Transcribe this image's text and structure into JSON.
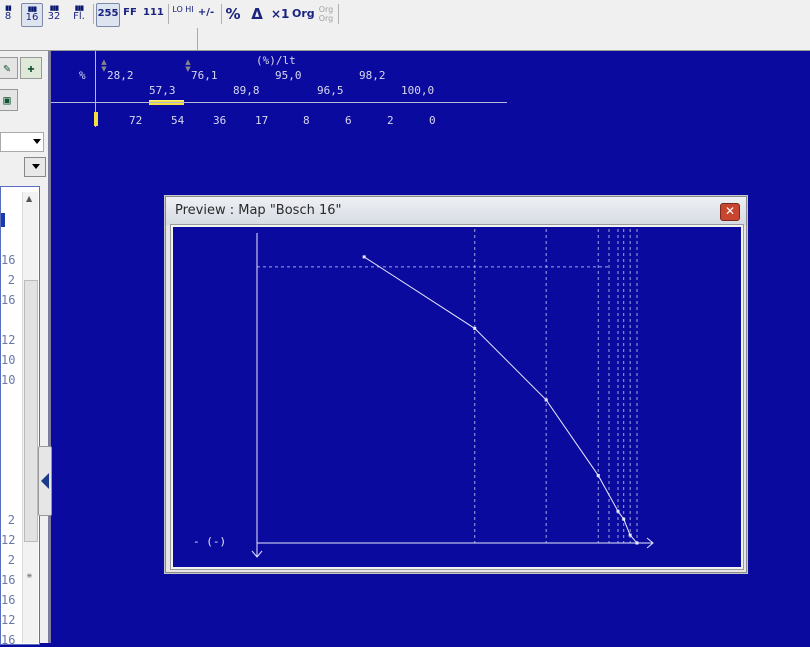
{
  "toolbar": {
    "buttons": [
      {
        "name": "8-bit-button",
        "label": "8",
        "selected": false
      },
      {
        "name": "16-bit-button",
        "label": "16",
        "selected": true
      },
      {
        "name": "32-bit-button",
        "label": "32",
        "selected": false
      },
      {
        "name": "float-button",
        "label": "Fl.",
        "selected": false
      },
      {
        "name": "decimal-255-button",
        "label": "255",
        "selected": true
      },
      {
        "name": "hex-ff-button",
        "label": "FF",
        "selected": false
      },
      {
        "name": "binary-111-button",
        "label": "111",
        "selected": false
      },
      {
        "name": "lohi-button",
        "label": "LO HI",
        "selected": false
      },
      {
        "name": "sign-button",
        "label": "+/-",
        "selected": false
      },
      {
        "name": "percent-button",
        "label": "%",
        "selected": false
      },
      {
        "name": "delta-button",
        "label": "Δ",
        "selected": false
      },
      {
        "name": "times-one-button",
        "label": "×1",
        "selected": false
      },
      {
        "name": "org-button",
        "label": "Org",
        "selected": false
      },
      {
        "name": "org-org-button",
        "label": "Org Org",
        "selected": false
      }
    ]
  },
  "map": {
    "unit_label": "(%)/lt",
    "row_label": "%",
    "axis_top": [
      "28,2",
      "76,1",
      "95,0",
      "98,2"
    ],
    "axis_bottom": [
      "57,3",
      "89,8",
      "96,5",
      "100,0"
    ],
    "values": [
      "72",
      "54",
      "36",
      "17",
      "8",
      "6",
      "2",
      "0"
    ]
  },
  "left_list": {
    "numbers": [
      "16",
      "2",
      "16",
      "12",
      "10",
      "10",
      "2",
      "12",
      "2",
      "16",
      "16",
      "12",
      "16"
    ]
  },
  "preview": {
    "title": "Preview : Map \"Bosch 16\"",
    "close_label": "✕",
    "axis_label": "- (-)"
  },
  "chart_data": {
    "type": "line",
    "x": [
      28.2,
      57.3,
      76.1,
      89.8,
      95.0,
      96.5,
      98.2,
      100.0
    ],
    "values": [
      72,
      54,
      36,
      17,
      8,
      6,
      2,
      0
    ],
    "title": "",
    "xlabel": "",
    "ylabel": "- (-)",
    "xlim": [
      0,
      100
    ],
    "ylim": [
      0,
      76
    ],
    "grid": true,
    "colors": {
      "line": "#e8e8ff",
      "grid": "#9ea6e0",
      "axis": "#e8e8ff"
    }
  }
}
